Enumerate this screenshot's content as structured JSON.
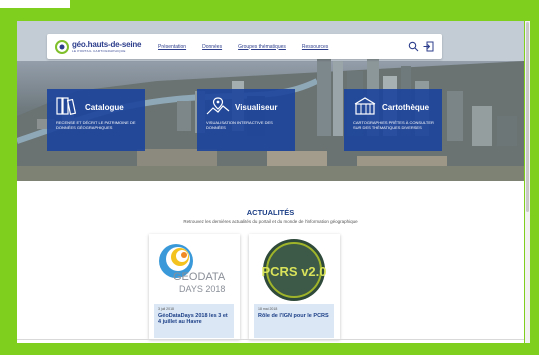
{
  "logo": {
    "name": "géo.hauts-de-seine",
    "tagline": "LE PORTAIL CARTOGRAPHIQUE"
  },
  "nav": {
    "items": [
      "Présentation",
      "Données",
      "Groupes thématiques",
      "Ressources"
    ]
  },
  "cards": [
    {
      "title": "Catalogue",
      "desc": "RECENSE ET DÉCRIT LE PATRIMOINE DE DONNÉES GÉOGRAPHIQUES",
      "icon": "books-icon"
    },
    {
      "title": "Visualiseur",
      "desc": "VISUALISATION INTERACTIVE DES DONNÉES",
      "icon": "map-pin-icon"
    },
    {
      "title": "Cartothèque",
      "desc": "CARTOGRAPHIES PRÊTES À CONSULTER SUR DES THÉMATIQUES DIVERSES",
      "icon": "map-library-icon"
    }
  ],
  "news_section": {
    "title": "ACTUALITÉS",
    "subtitle": "Retrouvez les dernières actualités du portail et du monde de l'information géographique"
  },
  "news": [
    {
      "logo_line1": "GEODATA",
      "logo_line2": "DAYS 2018",
      "date": "3 juil 2018",
      "title": "GéoDataDays 2018 les 3 et 4 juillet au Havre"
    },
    {
      "logo_text": "PCRS v2.0",
      "date": "18 mai 2018",
      "title": "Rôle de l'IGN pour le PCRS"
    }
  ],
  "colors": {
    "frame": "#7fcf1f",
    "brand": "#2d3e8c",
    "card": "#1c449c",
    "news_caption": "#dbe7f5"
  }
}
